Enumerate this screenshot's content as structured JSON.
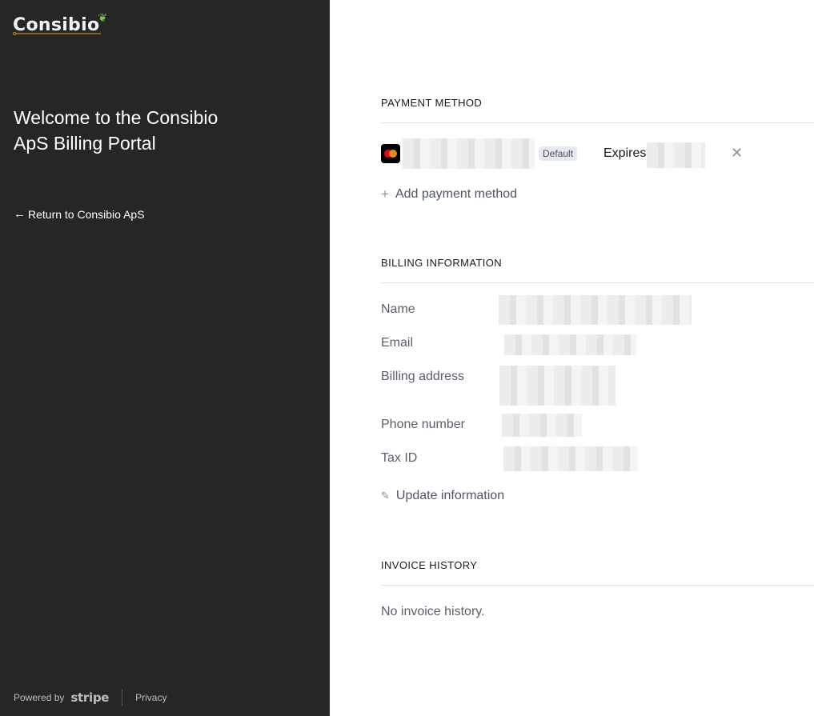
{
  "sidebar": {
    "logo_text": "Consibio",
    "welcome": "Welcome to the Consibio ApS Billing Portal",
    "return_link": "Return to Consibio ApS",
    "footer": {
      "powered_by": "Powered by",
      "stripe": "stripe",
      "privacy": "Privacy"
    }
  },
  "payment_method": {
    "title": "PAYMENT METHOD",
    "card": {
      "badge": "Default",
      "expires_label": "Expires"
    },
    "add_label": "Add payment method"
  },
  "billing_information": {
    "title": "BILLING INFORMATION",
    "fields": [
      {
        "label": "Name"
      },
      {
        "label": "Email"
      },
      {
        "label": "Billing address"
      },
      {
        "label": "Phone number"
      },
      {
        "label": "Tax ID"
      }
    ],
    "update_label": "Update information"
  },
  "invoice_history": {
    "title": "INVOICE HISTORY",
    "empty": "No invoice history."
  },
  "colors": {
    "sidebar_bg": "#262626",
    "logo_accent": "#7ec543",
    "badge_bg": "#e6e9ef"
  },
  "icons": [
    "arrow-left-icon",
    "mastercard-icon",
    "close-icon",
    "plus-icon",
    "edit-icon"
  ]
}
